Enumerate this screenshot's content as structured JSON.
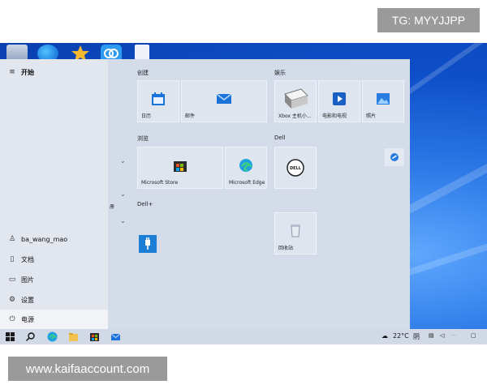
{
  "badge": {
    "tg": "TG: MYYJJPP"
  },
  "watermark": {
    "text": "www.kaifaaccount.com"
  },
  "start": {
    "header": "开始",
    "user": "ba_wang_mao",
    "documents": "文档",
    "pictures": "图片",
    "settings": "设置",
    "power": "电源",
    "side_label": "册"
  },
  "groups": {
    "create": "创建",
    "entertainment": "娱乐",
    "browse": "浏览",
    "dell": "Dell",
    "dell_plus": "Dell+"
  },
  "tiles": {
    "calendar": "日历",
    "mail": "邮件",
    "xbox": "Xbox 主机小...",
    "movies": "电影和电视",
    "photos": "照片",
    "store": "Microsoft Store",
    "edge": "Microsoft Edge",
    "recycle": "回收站"
  },
  "taskbar": {
    "temperature": "22°C",
    "weather_glyph": "阴",
    "search_hint": "Q"
  },
  "colors": {
    "accent": "#0078d4",
    "desktop": "#0d4fc9"
  }
}
